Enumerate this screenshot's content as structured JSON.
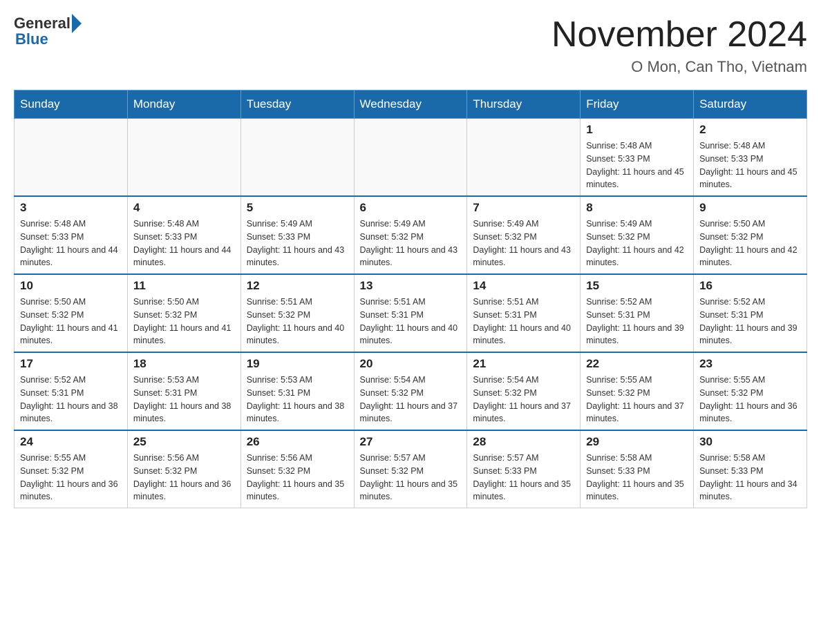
{
  "header": {
    "logo_general": "General",
    "logo_blue": "Blue",
    "month_title": "November 2024",
    "location": "O Mon, Can Tho, Vietnam"
  },
  "weekdays": [
    "Sunday",
    "Monday",
    "Tuesday",
    "Wednesday",
    "Thursday",
    "Friday",
    "Saturday"
  ],
  "weeks": [
    [
      {
        "day": "",
        "sunrise": "",
        "sunset": "",
        "daylight": ""
      },
      {
        "day": "",
        "sunrise": "",
        "sunset": "",
        "daylight": ""
      },
      {
        "day": "",
        "sunrise": "",
        "sunset": "",
        "daylight": ""
      },
      {
        "day": "",
        "sunrise": "",
        "sunset": "",
        "daylight": ""
      },
      {
        "day": "",
        "sunrise": "",
        "sunset": "",
        "daylight": ""
      },
      {
        "day": "1",
        "sunrise": "Sunrise: 5:48 AM",
        "sunset": "Sunset: 5:33 PM",
        "daylight": "Daylight: 11 hours and 45 minutes."
      },
      {
        "day": "2",
        "sunrise": "Sunrise: 5:48 AM",
        "sunset": "Sunset: 5:33 PM",
        "daylight": "Daylight: 11 hours and 45 minutes."
      }
    ],
    [
      {
        "day": "3",
        "sunrise": "Sunrise: 5:48 AM",
        "sunset": "Sunset: 5:33 PM",
        "daylight": "Daylight: 11 hours and 44 minutes."
      },
      {
        "day": "4",
        "sunrise": "Sunrise: 5:48 AM",
        "sunset": "Sunset: 5:33 PM",
        "daylight": "Daylight: 11 hours and 44 minutes."
      },
      {
        "day": "5",
        "sunrise": "Sunrise: 5:49 AM",
        "sunset": "Sunset: 5:33 PM",
        "daylight": "Daylight: 11 hours and 43 minutes."
      },
      {
        "day": "6",
        "sunrise": "Sunrise: 5:49 AM",
        "sunset": "Sunset: 5:32 PM",
        "daylight": "Daylight: 11 hours and 43 minutes."
      },
      {
        "day": "7",
        "sunrise": "Sunrise: 5:49 AM",
        "sunset": "Sunset: 5:32 PM",
        "daylight": "Daylight: 11 hours and 43 minutes."
      },
      {
        "day": "8",
        "sunrise": "Sunrise: 5:49 AM",
        "sunset": "Sunset: 5:32 PM",
        "daylight": "Daylight: 11 hours and 42 minutes."
      },
      {
        "day": "9",
        "sunrise": "Sunrise: 5:50 AM",
        "sunset": "Sunset: 5:32 PM",
        "daylight": "Daylight: 11 hours and 42 minutes."
      }
    ],
    [
      {
        "day": "10",
        "sunrise": "Sunrise: 5:50 AM",
        "sunset": "Sunset: 5:32 PM",
        "daylight": "Daylight: 11 hours and 41 minutes."
      },
      {
        "day": "11",
        "sunrise": "Sunrise: 5:50 AM",
        "sunset": "Sunset: 5:32 PM",
        "daylight": "Daylight: 11 hours and 41 minutes."
      },
      {
        "day": "12",
        "sunrise": "Sunrise: 5:51 AM",
        "sunset": "Sunset: 5:32 PM",
        "daylight": "Daylight: 11 hours and 40 minutes."
      },
      {
        "day": "13",
        "sunrise": "Sunrise: 5:51 AM",
        "sunset": "Sunset: 5:31 PM",
        "daylight": "Daylight: 11 hours and 40 minutes."
      },
      {
        "day": "14",
        "sunrise": "Sunrise: 5:51 AM",
        "sunset": "Sunset: 5:31 PM",
        "daylight": "Daylight: 11 hours and 40 minutes."
      },
      {
        "day": "15",
        "sunrise": "Sunrise: 5:52 AM",
        "sunset": "Sunset: 5:31 PM",
        "daylight": "Daylight: 11 hours and 39 minutes."
      },
      {
        "day": "16",
        "sunrise": "Sunrise: 5:52 AM",
        "sunset": "Sunset: 5:31 PM",
        "daylight": "Daylight: 11 hours and 39 minutes."
      }
    ],
    [
      {
        "day": "17",
        "sunrise": "Sunrise: 5:52 AM",
        "sunset": "Sunset: 5:31 PM",
        "daylight": "Daylight: 11 hours and 38 minutes."
      },
      {
        "day": "18",
        "sunrise": "Sunrise: 5:53 AM",
        "sunset": "Sunset: 5:31 PM",
        "daylight": "Daylight: 11 hours and 38 minutes."
      },
      {
        "day": "19",
        "sunrise": "Sunrise: 5:53 AM",
        "sunset": "Sunset: 5:31 PM",
        "daylight": "Daylight: 11 hours and 38 minutes."
      },
      {
        "day": "20",
        "sunrise": "Sunrise: 5:54 AM",
        "sunset": "Sunset: 5:32 PM",
        "daylight": "Daylight: 11 hours and 37 minutes."
      },
      {
        "day": "21",
        "sunrise": "Sunrise: 5:54 AM",
        "sunset": "Sunset: 5:32 PM",
        "daylight": "Daylight: 11 hours and 37 minutes."
      },
      {
        "day": "22",
        "sunrise": "Sunrise: 5:55 AM",
        "sunset": "Sunset: 5:32 PM",
        "daylight": "Daylight: 11 hours and 37 minutes."
      },
      {
        "day": "23",
        "sunrise": "Sunrise: 5:55 AM",
        "sunset": "Sunset: 5:32 PM",
        "daylight": "Daylight: 11 hours and 36 minutes."
      }
    ],
    [
      {
        "day": "24",
        "sunrise": "Sunrise: 5:55 AM",
        "sunset": "Sunset: 5:32 PM",
        "daylight": "Daylight: 11 hours and 36 minutes."
      },
      {
        "day": "25",
        "sunrise": "Sunrise: 5:56 AM",
        "sunset": "Sunset: 5:32 PM",
        "daylight": "Daylight: 11 hours and 36 minutes."
      },
      {
        "day": "26",
        "sunrise": "Sunrise: 5:56 AM",
        "sunset": "Sunset: 5:32 PM",
        "daylight": "Daylight: 11 hours and 35 minutes."
      },
      {
        "day": "27",
        "sunrise": "Sunrise: 5:57 AM",
        "sunset": "Sunset: 5:32 PM",
        "daylight": "Daylight: 11 hours and 35 minutes."
      },
      {
        "day": "28",
        "sunrise": "Sunrise: 5:57 AM",
        "sunset": "Sunset: 5:33 PM",
        "daylight": "Daylight: 11 hours and 35 minutes."
      },
      {
        "day": "29",
        "sunrise": "Sunrise: 5:58 AM",
        "sunset": "Sunset: 5:33 PM",
        "daylight": "Daylight: 11 hours and 35 minutes."
      },
      {
        "day": "30",
        "sunrise": "Sunrise: 5:58 AM",
        "sunset": "Sunset: 5:33 PM",
        "daylight": "Daylight: 11 hours and 34 minutes."
      }
    ]
  ]
}
